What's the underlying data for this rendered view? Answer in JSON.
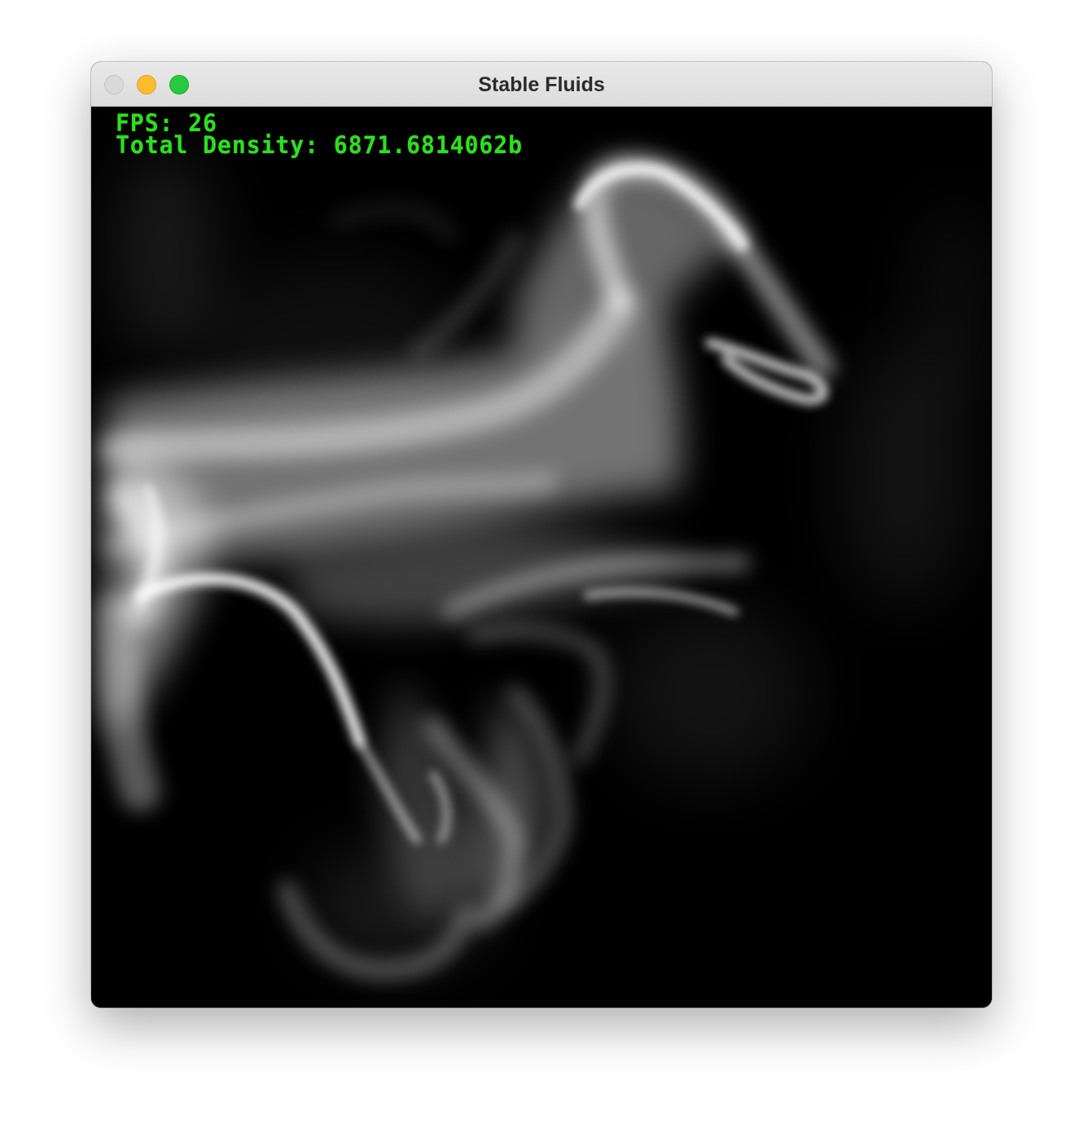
{
  "window": {
    "title": "Stable Fluids",
    "controls": [
      "close",
      "minimize",
      "zoom"
    ]
  },
  "hud": {
    "fps_text": "FPS: 26",
    "density_text": "Total Density: 6871.6814062b"
  },
  "colors": {
    "hud_text": "#2de01d",
    "canvas_background": "#000000",
    "smoke": "#ffffff"
  }
}
